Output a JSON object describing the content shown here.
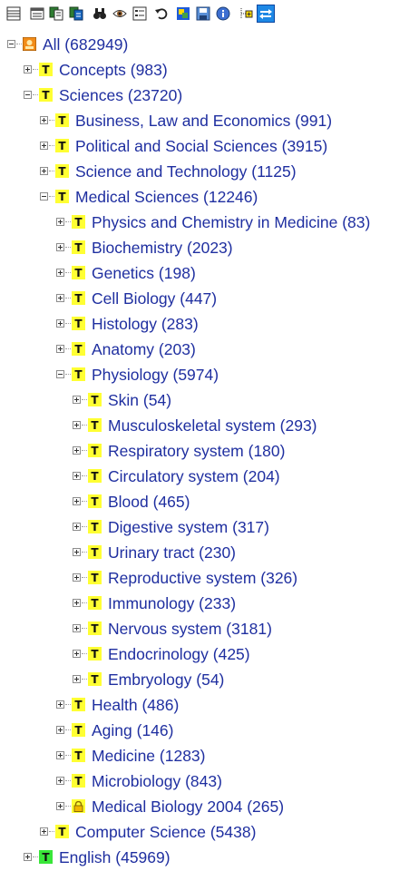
{
  "toolbar": {
    "buttons": [
      {
        "icon": "list-view-icon"
      },
      {
        "icon": "details-view-icon"
      },
      {
        "icon": "copy-pages-icon"
      },
      {
        "icon": "paste-pages-icon"
      },
      {
        "icon": "binoculars-icon"
      },
      {
        "icon": "eye-icon"
      },
      {
        "icon": "properties-icon"
      },
      {
        "icon": "undo-icon"
      },
      {
        "icon": "refresh-colored-icon"
      },
      {
        "icon": "save-icon"
      },
      {
        "icon": "info-icon"
      },
      {
        "icon": "add-node-icon"
      },
      {
        "icon": "sync-icon",
        "active": true
      }
    ]
  },
  "tree": {
    "nodes": [
      {
        "label": "All (682949)",
        "level": 0,
        "expander": "minus",
        "icon": "root"
      },
      {
        "label": "Concepts (983)",
        "level": 1,
        "expander": "plus",
        "icon": "yellow"
      },
      {
        "label": "Sciences (23720)",
        "level": 1,
        "expander": "minus",
        "icon": "yellow"
      },
      {
        "label": "Business, Law and Economics (991)",
        "level": 2,
        "expander": "plus",
        "icon": "yellow"
      },
      {
        "label": "Political and Social Sciences (3915)",
        "level": 2,
        "expander": "plus",
        "icon": "yellow"
      },
      {
        "label": "Science and Technology (1125)",
        "level": 2,
        "expander": "plus",
        "icon": "yellow"
      },
      {
        "label": "Medical Sciences (12246)",
        "level": 2,
        "expander": "minus",
        "icon": "yellow"
      },
      {
        "label": "Physics and Chemistry in Medicine (83)",
        "level": 3,
        "expander": "plus",
        "icon": "yellow"
      },
      {
        "label": "Biochemistry (2023)",
        "level": 3,
        "expander": "plus",
        "icon": "yellow"
      },
      {
        "label": "Genetics (198)",
        "level": 3,
        "expander": "plus",
        "icon": "yellow"
      },
      {
        "label": "Cell Biology (447)",
        "level": 3,
        "expander": "plus",
        "icon": "yellow"
      },
      {
        "label": "Histology (283)",
        "level": 3,
        "expander": "plus",
        "icon": "yellow"
      },
      {
        "label": "Anatomy (203)",
        "level": 3,
        "expander": "plus",
        "icon": "yellow"
      },
      {
        "label": "Physiology (5974)",
        "level": 3,
        "expander": "minus",
        "icon": "yellow"
      },
      {
        "label": "Skin (54)",
        "level": 4,
        "expander": "plus",
        "icon": "yellow"
      },
      {
        "label": "Musculoskeletal system (293)",
        "level": 4,
        "expander": "plus",
        "icon": "yellow"
      },
      {
        "label": "Respiratory system (180)",
        "level": 4,
        "expander": "plus",
        "icon": "yellow"
      },
      {
        "label": "Circulatory system (204)",
        "level": 4,
        "expander": "plus",
        "icon": "yellow"
      },
      {
        "label": "Blood (465)",
        "level": 4,
        "expander": "plus",
        "icon": "yellow"
      },
      {
        "label": "Digestive system (317)",
        "level": 4,
        "expander": "plus",
        "icon": "yellow"
      },
      {
        "label": "Urinary tract (230)",
        "level": 4,
        "expander": "plus",
        "icon": "yellow"
      },
      {
        "label": "Reproductive system (326)",
        "level": 4,
        "expander": "plus",
        "icon": "yellow"
      },
      {
        "label": "Immunology (233)",
        "level": 4,
        "expander": "plus",
        "icon": "yellow"
      },
      {
        "label": "Nervous system (3181)",
        "level": 4,
        "expander": "plus",
        "icon": "yellow"
      },
      {
        "label": "Endocrinology (425)",
        "level": 4,
        "expander": "plus",
        "icon": "yellow"
      },
      {
        "label": "Embryology (54)",
        "level": 4,
        "expander": "plus",
        "icon": "yellow"
      },
      {
        "label": "Health (486)",
        "level": 3,
        "expander": "plus",
        "icon": "yellow"
      },
      {
        "label": "Aging (146)",
        "level": 3,
        "expander": "plus",
        "icon": "yellow"
      },
      {
        "label": "Medicine (1283)",
        "level": 3,
        "expander": "plus",
        "icon": "yellow"
      },
      {
        "label": "Microbiology (843)",
        "level": 3,
        "expander": "plus",
        "icon": "yellow"
      },
      {
        "label": "Medical Biology 2004 (265)",
        "level": 3,
        "expander": "plus",
        "icon": "lock"
      },
      {
        "label": "Computer Science (5438)",
        "level": 2,
        "expander": "plus",
        "icon": "yellow"
      },
      {
        "label": "English (45969)",
        "level": 1,
        "expander": "plus",
        "icon": "green"
      }
    ]
  }
}
